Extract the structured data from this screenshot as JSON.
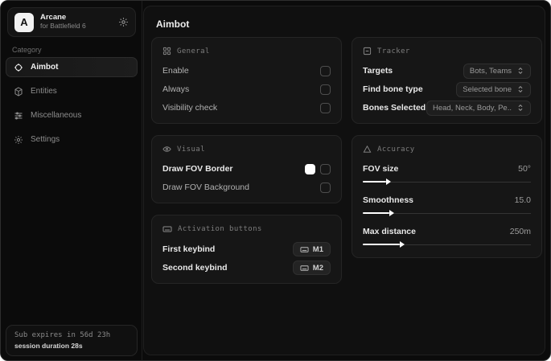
{
  "colors": {
    "accent": "#ffffff",
    "app_bg": "#0b0b0b",
    "card_bg": "#161616",
    "swatch": "#ffffff"
  },
  "sidebar": {
    "logo_letter": "A",
    "app_name": "Arcane",
    "app_subtitle": "for Battlefield 6",
    "category_label": "Category",
    "items": [
      {
        "label": "Aimbot",
        "icon": "crosshair-icon",
        "active": true
      },
      {
        "label": "Entities",
        "icon": "entities-icon",
        "active": false
      },
      {
        "label": "Miscellaneous",
        "icon": "sliders-icon",
        "active": false
      },
      {
        "label": "Settings",
        "icon": "gear-icon",
        "active": false
      }
    ],
    "subscription": {
      "expires": "Sub expires in 56d 23h",
      "session": "session duration 28s"
    }
  },
  "main": {
    "title": "Aimbot",
    "general": {
      "title": "General",
      "rows": [
        {
          "label": "Enable",
          "checked": false
        },
        {
          "label": "Always",
          "checked": false
        },
        {
          "label": "Visibility check",
          "checked": false
        }
      ]
    },
    "visual": {
      "title": "Visual",
      "rows": [
        {
          "label": "Draw FOV Border",
          "checked": false,
          "swatch": "#ffffff"
        },
        {
          "label": "Draw FOV Background",
          "checked": false
        }
      ]
    },
    "activation": {
      "title": "Activation buttons",
      "rows": [
        {
          "label": "First keybind",
          "key": "M1"
        },
        {
          "label": "Second keybind",
          "key": "M2"
        }
      ]
    },
    "tracker": {
      "title": "Tracker",
      "rows": [
        {
          "label": "Targets",
          "value": "Bots, Teams"
        },
        {
          "label": "Find bone type",
          "value": "Selected bone"
        },
        {
          "label": "Bones Selected",
          "value": "Head, Neck, Body, Pe.."
        }
      ]
    },
    "accuracy": {
      "title": "Accuracy",
      "sliders": [
        {
          "label": "FOV size",
          "value": "50°",
          "fill_pct": 14
        },
        {
          "label": "Smoothness",
          "value": "15.0",
          "fill_pct": 16
        },
        {
          "label": "Max distance",
          "value": "250m",
          "fill_pct": 22
        }
      ]
    }
  }
}
